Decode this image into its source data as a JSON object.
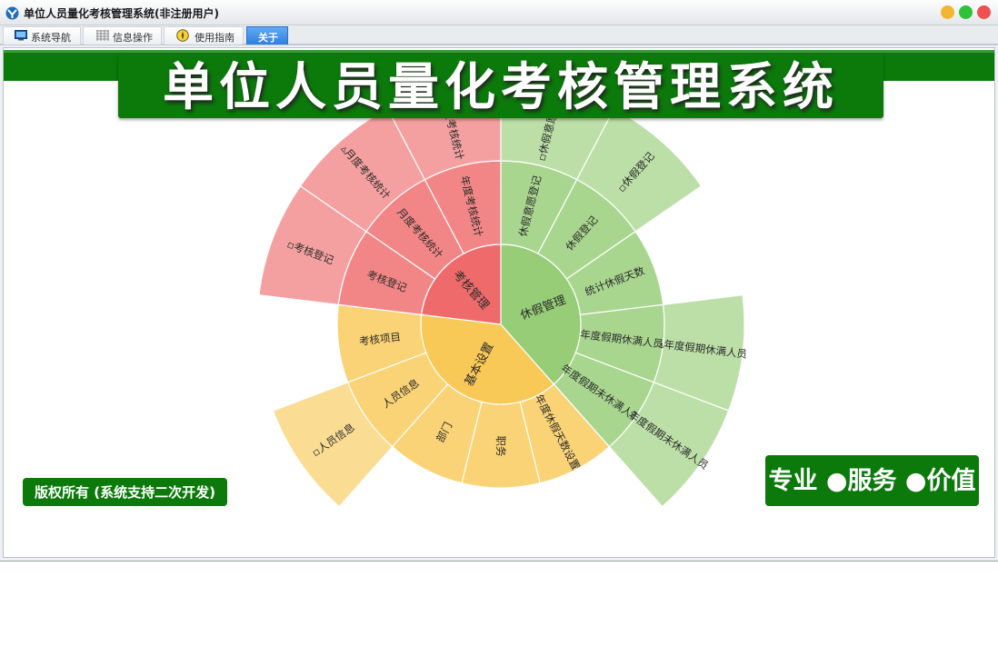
{
  "window": {
    "title": "单位人员量化考核管理系统(非注册用户)",
    "controls": [
      {
        "name": "minimize",
        "color": "#f2b632"
      },
      {
        "name": "maximize",
        "color": "#30c03a"
      },
      {
        "name": "close",
        "color": "#f05050"
      }
    ]
  },
  "tabs": [
    {
      "label": "系统导航",
      "icon": "monitor-icon",
      "active": false
    },
    {
      "label": "信息操作",
      "icon": "grid-icon",
      "active": false
    },
    {
      "label": "使用指南",
      "icon": "compass-icon",
      "active": false
    },
    {
      "label": "关于",
      "icon": "",
      "active": true
    }
  ],
  "banner": {
    "title": "单位人员量化考核管理系统"
  },
  "footer": {
    "copyright": "版权所有 (系统支持二次开发)",
    "slogan": "专业 ●服务 ●价值"
  },
  "colors": {
    "brand_green": "#0b7a0b",
    "tab_active": "#2d7fe0"
  },
  "chart_data": {
    "type": "sunburst",
    "nodes": [
      {
        "label": "休假管理",
        "color": "#96cd76",
        "children": [
          {
            "label": "休假意愿登记",
            "children": [
              {
                "label": "▫休假意愿登记",
                "children": []
              }
            ]
          },
          {
            "label": "休假登记",
            "children": [
              {
                "label": "▫休假登记",
                "children": []
              }
            ]
          },
          {
            "label": "统计休假天数",
            "children": []
          },
          {
            "label": "年度假期休满人员",
            "children": [
              {
                "label": "▵年度假期休满人员",
                "children": []
              }
            ]
          },
          {
            "label": "年度假期未休满人员",
            "children": [
              {
                "label": "年度假期未休满人员",
                "children": []
              }
            ]
          }
        ]
      },
      {
        "label": "基本设置",
        "color": "#f8c957",
        "children": [
          {
            "label": "年度休假天数设置",
            "children": []
          },
          {
            "label": "职务",
            "children": []
          },
          {
            "label": "部门",
            "children": []
          },
          {
            "label": "人员信息",
            "children": [
              {
                "label": "▫人员信息",
                "children": []
              }
            ]
          },
          {
            "label": "考核项目",
            "children": []
          }
        ]
      },
      {
        "label": "考核管理",
        "color": "#ef6b6b",
        "children": [
          {
            "label": "考核登记",
            "children": [
              {
                "label": "▫考核登记",
                "children": []
              }
            ]
          },
          {
            "label": "月度考核统计",
            "children": [
              {
                "label": "▵月度考核统计",
                "children": []
              }
            ]
          },
          {
            "label": "年度考核统计",
            "children": [
              {
                "label": "▵年度考核统计",
                "children": []
              }
            ]
          }
        ]
      }
    ]
  }
}
